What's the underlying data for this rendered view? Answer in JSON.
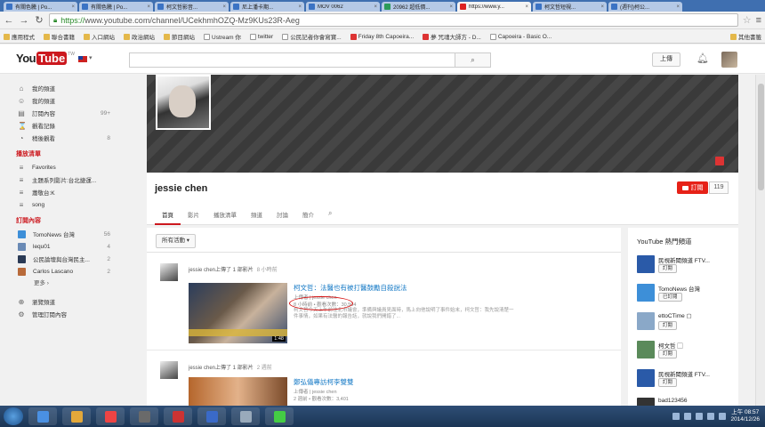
{
  "browser": {
    "tabs": [
      {
        "title": "有關色騰 | Po...",
        "fav": "default"
      },
      {
        "title": "有關色騰 | Po...",
        "fav": "default"
      },
      {
        "title": "柯文哲影音...",
        "fav": "default"
      },
      {
        "title": "尼上潘卡期...",
        "fav": "default"
      },
      {
        "title": "MOV 0062",
        "fav": "default"
      },
      {
        "title": "20962 超低價...",
        "fav": "gd"
      },
      {
        "title": "https://www.y...",
        "fav": "yt",
        "active": true
      },
      {
        "title": "柯文哲短視...",
        "fav": "default"
      },
      {
        "title": "(週刊)柯公...",
        "fav": "default"
      }
    ],
    "url_scheme": "https://",
    "url_rest": "www.youtube.com/channel/UCekhmhOZQ-Mz9KUs23R-Aeg",
    "bookmarks": [
      {
        "label": "應用程式",
        "icon": "folder"
      },
      {
        "label": "聯合書籍",
        "icon": "folder"
      },
      {
        "label": "入口網站",
        "icon": "folder"
      },
      {
        "label": "政治網站",
        "icon": "folder"
      },
      {
        "label": "節目網站",
        "icon": "folder"
      },
      {
        "label": "Ustream 你",
        "icon": "page"
      },
      {
        "label": "twitter",
        "icon": "page"
      },
      {
        "label": "公民記者你會寫寶...",
        "icon": "page"
      },
      {
        "label": "Friday 8th Capoeira...",
        "icon": "red"
      },
      {
        "label": "夢 咒魂大師方 - D...",
        "icon": "red"
      },
      {
        "label": "Capoeira - Basic O...",
        "icon": "page"
      }
    ],
    "bookmarks_right": "其他書籤"
  },
  "youtube": {
    "logo_you": "You",
    "logo_tube": "Tube",
    "logo_region": "TW",
    "upload_label": "上傳",
    "search_icon": "⌕"
  },
  "guide": {
    "top": [
      {
        "label": "我的頻道",
        "icon": "home-icon",
        "glyph": "⌂"
      },
      {
        "label": "我的頻道",
        "icon": "user-icon",
        "glyph": "☺"
      },
      {
        "label": "訂閱內容",
        "icon": "subscriptions-icon",
        "glyph": "▤",
        "count": "99+"
      },
      {
        "label": "觀看記錄",
        "icon": "history-icon",
        "glyph": "⌛"
      },
      {
        "label": "稍後觀看",
        "icon": "clock-icon",
        "glyph": "◔",
        "count": "8"
      }
    ],
    "playlists_title": "播放清單",
    "playlists": [
      {
        "label": "Favorites",
        "glyph": "≡"
      },
      {
        "label": "主題系列影片:台北捷運...",
        "glyph": "≡"
      },
      {
        "label": "蕭敬台:K",
        "glyph": "≡"
      },
      {
        "label": "song",
        "glyph": "≡"
      }
    ],
    "subs_title": "訂閱內容",
    "subs": [
      {
        "label": "TomoNews 台灣",
        "color": "#3d8fd8",
        "count": "56"
      },
      {
        "label": "lequ01",
        "color": "#6a8ab5",
        "count": "4"
      },
      {
        "label": "公民論壇與台灣民主...",
        "color": "#2a3a55",
        "count": "2"
      },
      {
        "label": "Carlos Lascano",
        "color": "#b86a3a",
        "count": "2"
      }
    ],
    "more_label": "更多 ›",
    "bottom": [
      {
        "label": "瀏覽頻道",
        "glyph": "⊕"
      },
      {
        "label": "管理訂閱內容",
        "glyph": "⚙"
      }
    ]
  },
  "channel": {
    "name": "jessie chen",
    "subscribe_label": "訂閱",
    "subscriber_count": "119",
    "tabs": [
      "首頁",
      "影片",
      "播放清單",
      "頻道",
      "討論",
      "簡介"
    ],
    "active_tab": 0
  },
  "feed": {
    "activity_label": "所有活動 ▾",
    "items": [
      {
        "meta": "jessie chen上傳了 1 部影片",
        "time": "8 小時前",
        "title": "柯文哲：法醫也有被打醫鼓勵自殺說法",
        "by": "上傳者 | jessie chen",
        "stats": "8 小時前 • 觀看次數：30,504",
        "desc": "柯文哲今天上午前往北市議會，準備與議員見面時，馬上向他說明了事件始末，柯文哲：我先說清楚一件事情，如果有法醫的報告話，就說我們開錯了...",
        "duration": "1:48"
      },
      {
        "meta": "jessie chen上傳了 1 部影片",
        "time": "2 週前",
        "title": "鄭弘儀專訪柯李雙雙",
        "by": "上傳者 | jessie chen",
        "stats": "2 週前 • 觀看次數：3,401"
      }
    ]
  },
  "sidebar": {
    "title": "YouTube 熱門頻道",
    "channels": [
      {
        "name": "民視新聞頻道 FTV...",
        "button": "訂閱",
        "color": "#2a5aa8"
      },
      {
        "name": "TomoNews 台灣",
        "button": "已訂閱",
        "color": "#3d8fd8"
      },
      {
        "name": "ettoCTime ▢",
        "button": "訂閱",
        "color": "#8aa8c8"
      },
      {
        "name": "柯文哲 ▢",
        "button": "訂閱",
        "color": "#5a8a5a"
      },
      {
        "name": "民視新聞頻道 FTV...",
        "button": "訂閱",
        "color": "#2a5aa8"
      },
      {
        "name": "bad123456",
        "button": "",
        "color": "#333"
      }
    ]
  },
  "taskbar": {
    "apps": [
      "#4a90e2",
      "#e3a83a",
      "#e44",
      "#6a6a6a",
      "#c33",
      "#3a6ac8",
      "#9ab",
      "#4c4"
    ],
    "time": "上午 08:57",
    "date": "2014/12/26"
  }
}
